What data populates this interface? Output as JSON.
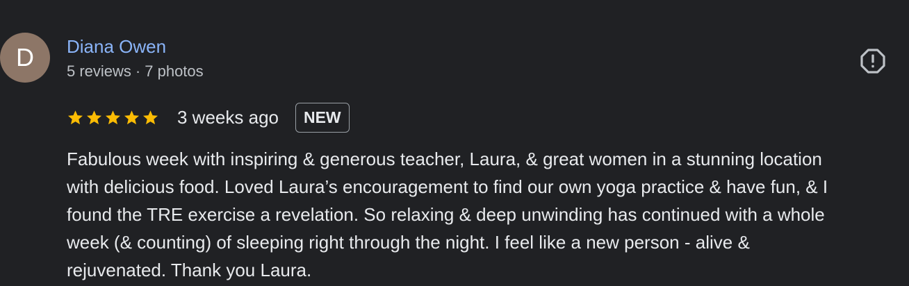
{
  "review": {
    "avatar_initial": "D",
    "avatar_color": "#8d7667",
    "author_name": "Diana Owen",
    "reviews_count": "5 reviews",
    "separator": "·",
    "photos_count": "7 photos",
    "rating": 5,
    "rating_max": 5,
    "date": "3 weeks ago",
    "badge": "NEW",
    "text_lines": [
      "Fabulous week with inspiring & generous teacher, Laura, & great women in a stunning location",
      "with delicious food. Loved Laura’s encouragement to find our own yoga practice & have fun, & I",
      "found the TRE exercise a revelation. So relaxing & deep unwinding has continued with a whole",
      "week (& counting) of sleeping right through the night. I feel like a new person - alive &",
      "rejuvenated. Thank you Laura."
    ],
    "report_icon": "report-icon",
    "star_icon": "star-icon"
  },
  "colors": {
    "background": "#202124",
    "author_link": "#8ab4f8",
    "star": "#fbbc04",
    "text": "#e8eaed",
    "secondary_text": "#bdc1c6"
  }
}
